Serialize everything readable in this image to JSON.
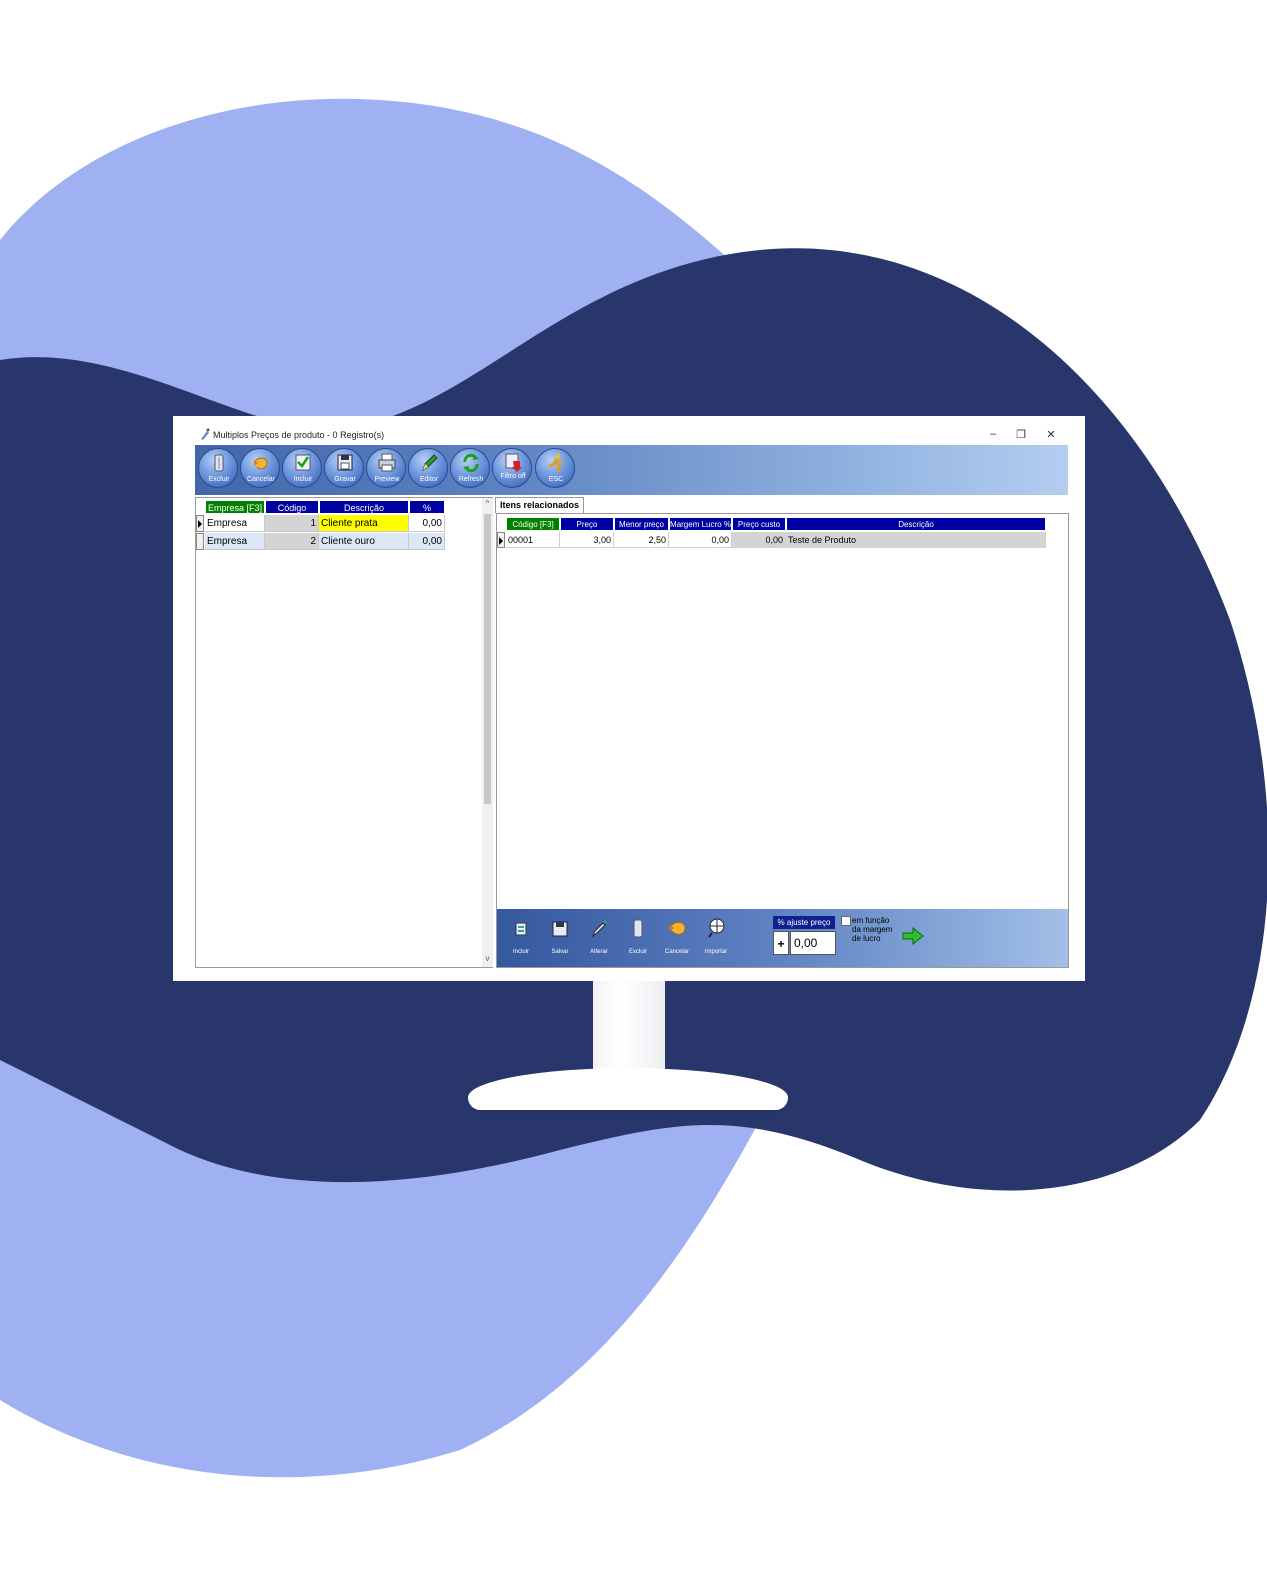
{
  "window": {
    "title": "Multiplos Preços de produto - 0 Registro(s)",
    "minimize": "–",
    "restore": "❐",
    "close": "✕"
  },
  "toolbar": [
    {
      "label": "Excluir",
      "icon": "trash-icon"
    },
    {
      "label": "Cancelar",
      "icon": "undo-hand-icon"
    },
    {
      "label": "Incluir",
      "icon": "check-icon"
    },
    {
      "label": "Gravar",
      "icon": "floppy-icon"
    },
    {
      "label": "Preview",
      "icon": "printer-icon"
    },
    {
      "label": "Editor",
      "icon": "pencil-icon"
    },
    {
      "label": "Refresh",
      "icon": "refresh-icon"
    },
    {
      "label": "Filtro off",
      "icon": "filter-icon"
    },
    {
      "label": "ESC",
      "icon": "running-man-icon"
    }
  ],
  "left_grid": {
    "columns": [
      "Empresa [F3]",
      "Código tabela",
      "Descrição",
      "% ajuste"
    ],
    "rows": [
      {
        "empresa": "Empresa",
        "codigo": "1",
        "descricao": "Cliente prata",
        "ajuste": "0,00"
      },
      {
        "empresa": "Empresa",
        "codigo": "2",
        "descricao": "Cliente ouro",
        "ajuste": "0,00"
      }
    ],
    "scroll_up": "^",
    "scroll_down": "v"
  },
  "tab": {
    "label": "Itens relacionados"
  },
  "items_grid": {
    "columns": [
      "Código [F3]",
      "Preço",
      "Menor preço",
      "Margem Lucro %",
      "Preço custo",
      "Descrição"
    ],
    "rows": [
      {
        "codigo": "00001",
        "preco": "3,00",
        "menor_preco": "2,50",
        "margem": "0,00",
        "custo": "0,00",
        "descricao": "Teste de Produto"
      }
    ]
  },
  "bottom_bar": {
    "buttons": [
      {
        "label": "Incluir",
        "icon": "new-document-icon"
      },
      {
        "label": "Salvar",
        "icon": "floppy-icon"
      },
      {
        "label": "Alterar",
        "icon": "pen-icon"
      },
      {
        "label": "Excluir",
        "icon": "trash-icon"
      },
      {
        "label": "Cancelar",
        "icon": "undo-hand-icon"
      },
      {
        "label": "Importar",
        "icon": "globe-search-icon"
      }
    ],
    "adjust_label": "% ajuste preço",
    "adjust_sign": "+",
    "adjust_value": "0,00",
    "checkbox_label_1": "em função",
    "checkbox_label_2": "da margem",
    "checkbox_label_3": "de lucro"
  },
  "colors": {
    "header_green": "#008000",
    "header_blue": "#0000a0",
    "highlight_yellow": "#ffff00",
    "row_blue": "#dce8f7",
    "bg_dark": "#28366b",
    "bg_light": "#a0b1f3"
  }
}
